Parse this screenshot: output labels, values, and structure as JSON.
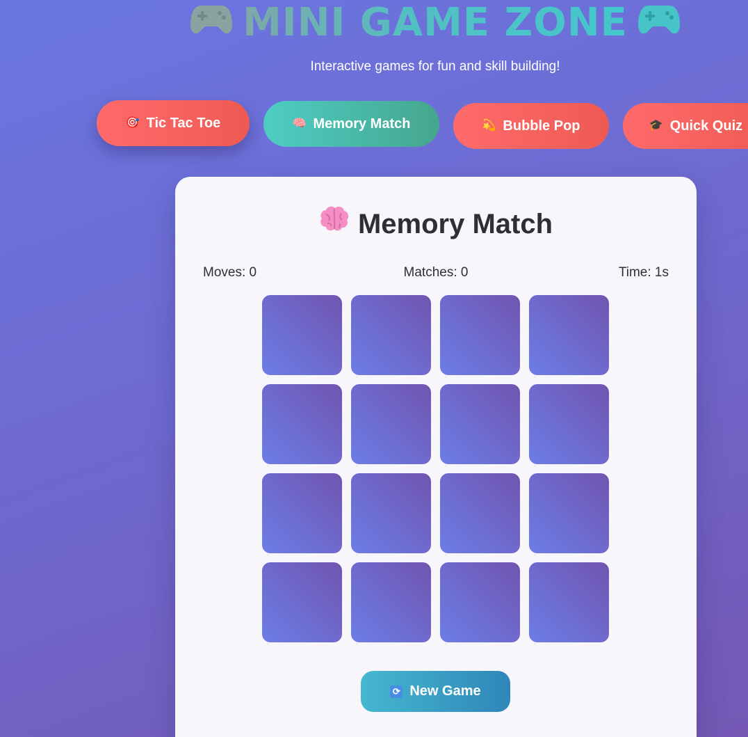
{
  "header": {
    "title": "MINI GAME ZONE",
    "subtitle": "Interactive games for fun and skill building!",
    "left_icon": "gamepad-icon",
    "right_icon": "gamepad-icon"
  },
  "tabs": [
    {
      "icon": "🎯",
      "label": "Tic Tac Toe",
      "color": "#ff6b6b",
      "active": false
    },
    {
      "icon": "🧠",
      "label": "Memory Match",
      "color": "#4ecdc4",
      "active": true
    },
    {
      "icon": "💫",
      "label": "Bubble Pop",
      "color": "#ff6b6b",
      "active": false
    },
    {
      "icon": "🎓",
      "label": "Quick Quiz",
      "color": "#ff6b6b",
      "active": false
    }
  ],
  "game": {
    "title": "Memory Match",
    "title_icon": "brain-icon",
    "stats": {
      "moves": "Moves: 0",
      "matches": "Matches: 0",
      "time": "Time: 1s"
    },
    "board": {
      "rows": 4,
      "columns": 4,
      "cards_face_down": 16
    },
    "new_game": {
      "icon": "🔄",
      "label": "New Game"
    }
  },
  "colors": {
    "background_start": "#6a76e0",
    "background_end": "#7458b4",
    "card_back_start": "#6b7ee6",
    "card_back_end": "#7154b0",
    "title_gradient_start": "#7fa8a8",
    "title_gradient_end": "#44c7cc"
  }
}
